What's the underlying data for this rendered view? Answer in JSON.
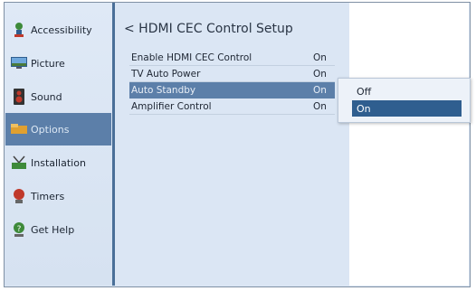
{
  "sidebar": {
    "items": [
      {
        "label": "Accessibility",
        "icon": "accessibility-icon"
      },
      {
        "label": "Picture",
        "icon": "picture-icon"
      },
      {
        "label": "Sound",
        "icon": "sound-icon"
      },
      {
        "label": "Options",
        "icon": "options-icon",
        "selected": true
      },
      {
        "label": "Installation",
        "icon": "installation-icon"
      },
      {
        "label": "Timers",
        "icon": "timers-icon"
      },
      {
        "label": "Get Help",
        "icon": "help-icon"
      }
    ]
  },
  "main": {
    "title": "< HDMI CEC Control Setup",
    "rows": [
      {
        "label": "Enable HDMI CEC Control",
        "value": "On"
      },
      {
        "label": "TV Auto Power",
        "value": "On"
      },
      {
        "label": "Auto Standby",
        "value": "On",
        "highlighted": true
      },
      {
        "label": "Amplifier Control",
        "value": "On"
      }
    ]
  },
  "popup": {
    "options": [
      "Off",
      "On"
    ],
    "selected": "On"
  },
  "colors": {
    "selection": "#5c7fa9",
    "popup_selection": "#2f5e8f",
    "panel": "#dbe6f4"
  }
}
